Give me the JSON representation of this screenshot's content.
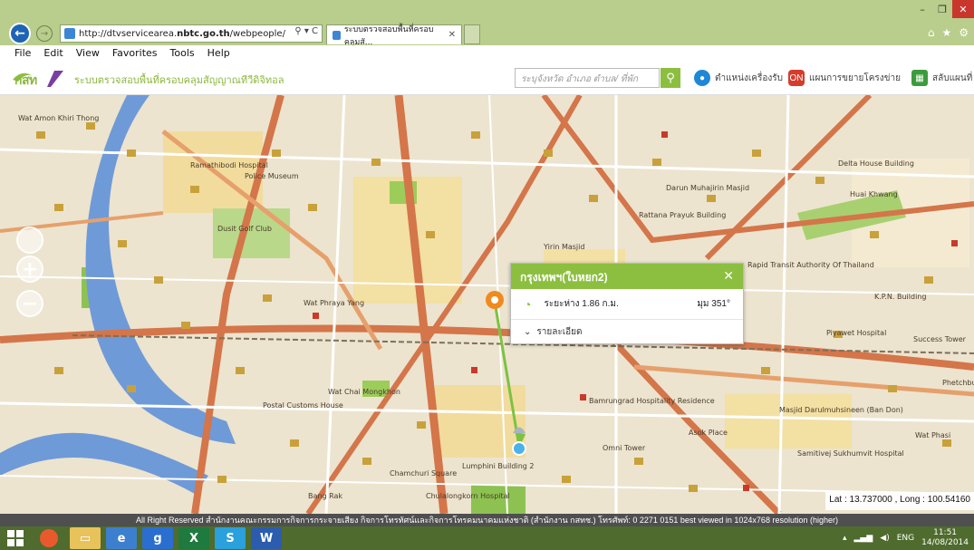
{
  "browser": {
    "url_prefix": "http://dtvservicearea.",
    "url_domain": "nbtc.go.th",
    "url_suffix": "/webpeople/",
    "tab_title": "ระบบตรวจสอบพื้นที่ครอบคลุมสั...",
    "search_glyph": "⚲ ▾ C",
    "menu": [
      "File",
      "Edit",
      "View",
      "Favorites",
      "Tools",
      "Help"
    ]
  },
  "site": {
    "logo_text": "กสท",
    "title": "ระบบตรวจสอบพื้นที่ครอบคลุมสัญญาณทีวีดิจิทอล",
    "search_placeholder": "ระบุจังหวัด อำเภอ ตำบล/ ที่พัก",
    "header_items": [
      {
        "label": "ตำแหน่งเครื่องรับ",
        "icon": "location-icon",
        "color": "#1e88d6"
      },
      {
        "label": "แผนการขยายโครงข่าย",
        "icon": "network-plan-icon",
        "color": "#d63c2c"
      },
      {
        "label": "สลับแผนที่",
        "icon": "switch-map-icon",
        "color": "#3c9c3c"
      }
    ]
  },
  "map": {
    "popup": {
      "title": "กรุงเทพฯ(ใบหยก2)",
      "distance": "ระยะห่าง 1.86 ก.ม.",
      "angle": "มุม 351°",
      "details_label": "รายละเอียด"
    },
    "labels": [
      "Wat Amon Khiri Thong",
      "Rattana Prayuk Building",
      "Ramathibodi Hospital",
      "Dusit Golf Club",
      "Wat Phraya Yang",
      "Wat Chai Mongkhon",
      "Postal Customs House",
      "Police Museum",
      "Delta House Building",
      "Huai Khwang",
      "Rapid Transit Authority Of Thailand",
      "K.P.N. Building",
      "Piyawet Hospital",
      "Success Tower",
      "Bamrungrad Hospitality Residence",
      "Masjid Darulmuhsineen (Ban Don)",
      "Samitivej Sukhumvit Hospital",
      "Asok Place",
      "Omni Tower",
      "Lumphini Building 2",
      "Chamchuri Square",
      "Chulalongkorn Hospital",
      "Bang Rak",
      "Wat Phasi",
      "Yirin Masjid",
      "Darun Muhajirin Masjid",
      "Phetchburi"
    ],
    "coords": "Lat : 13.737000 , Long : 100.54160",
    "zoom_in": "+",
    "zoom_out": "−"
  },
  "footer": {
    "text": "All Right Reserved สำนักงานคณะกรรมการกิจการกระจายเสียง กิจการโทรทัศน์และกิจการโทรคมนาคมแห่งชาติ (สำนักงาน กสทช.) โทรศัพท์: 0 2271 0151 best viewed in 1024x768 resolution (higher)"
  },
  "taskbar": {
    "lang": "ENG",
    "time": "11:51",
    "date": "14/08/2014"
  }
}
